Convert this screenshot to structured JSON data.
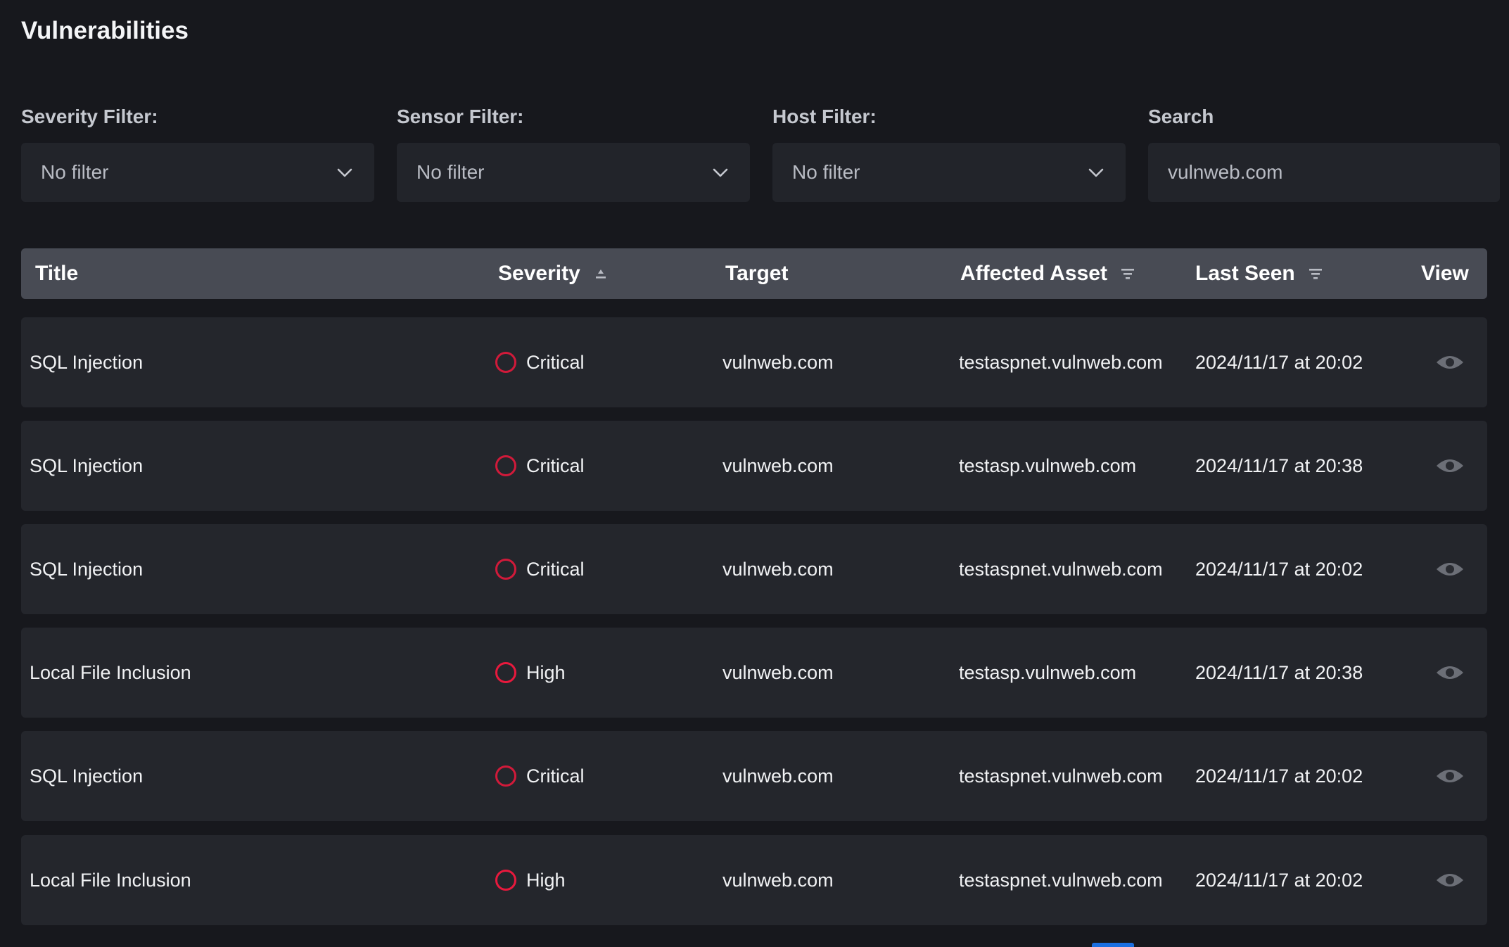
{
  "page": {
    "title": "Vulnerabilities"
  },
  "filters": {
    "severity": {
      "label": "Severity Filter:",
      "value": "No filter"
    },
    "sensor": {
      "label": "Sensor Filter:",
      "value": "No filter"
    },
    "host": {
      "label": "Host Filter:",
      "value": "No filter"
    },
    "search": {
      "label": "Search",
      "value": "vulnweb.com"
    }
  },
  "table": {
    "columns": {
      "title": "Title",
      "severity": "Severity",
      "target": "Target",
      "asset": "Affected Asset",
      "last_seen": "Last Seen",
      "view": "View"
    },
    "rows": [
      {
        "title": "SQL Injection",
        "severity": "Critical",
        "target": "vulnweb.com",
        "asset": "testaspnet.vulnweb.com",
        "last_seen": "2024/11/17 at 20:02"
      },
      {
        "title": "SQL Injection",
        "severity": "Critical",
        "target": "vulnweb.com",
        "asset": "testasp.vulnweb.com",
        "last_seen": "2024/11/17 at 20:38"
      },
      {
        "title": "SQL Injection",
        "severity": "Critical",
        "target": "vulnweb.com",
        "asset": "testaspnet.vulnweb.com",
        "last_seen": "2024/11/17 at 20:02"
      },
      {
        "title": "Local File Inclusion",
        "severity": "High",
        "target": "vulnweb.com",
        "asset": "testasp.vulnweb.com",
        "last_seen": "2024/11/17 at 20:38"
      },
      {
        "title": "SQL Injection",
        "severity": "Critical",
        "target": "vulnweb.com",
        "asset": "testaspnet.vulnweb.com",
        "last_seen": "2024/11/17 at 20:02"
      },
      {
        "title": "Local File Inclusion",
        "severity": "High",
        "target": "vulnweb.com",
        "asset": "testaspnet.vulnweb.com",
        "last_seen": "2024/11/17 at 20:02"
      }
    ]
  },
  "colors": {
    "background": "#17181d",
    "panel": "#24262c",
    "header": "#484b54",
    "critical": "#d11a3a",
    "high": "#e8193d",
    "accent": "#1b6fe0"
  },
  "icons": {
    "dropdown": "chevron-down-icon",
    "sort": "sort-icon",
    "filter": "filter-icon",
    "view": "eye-icon",
    "severity": "severity-ring-icon"
  }
}
